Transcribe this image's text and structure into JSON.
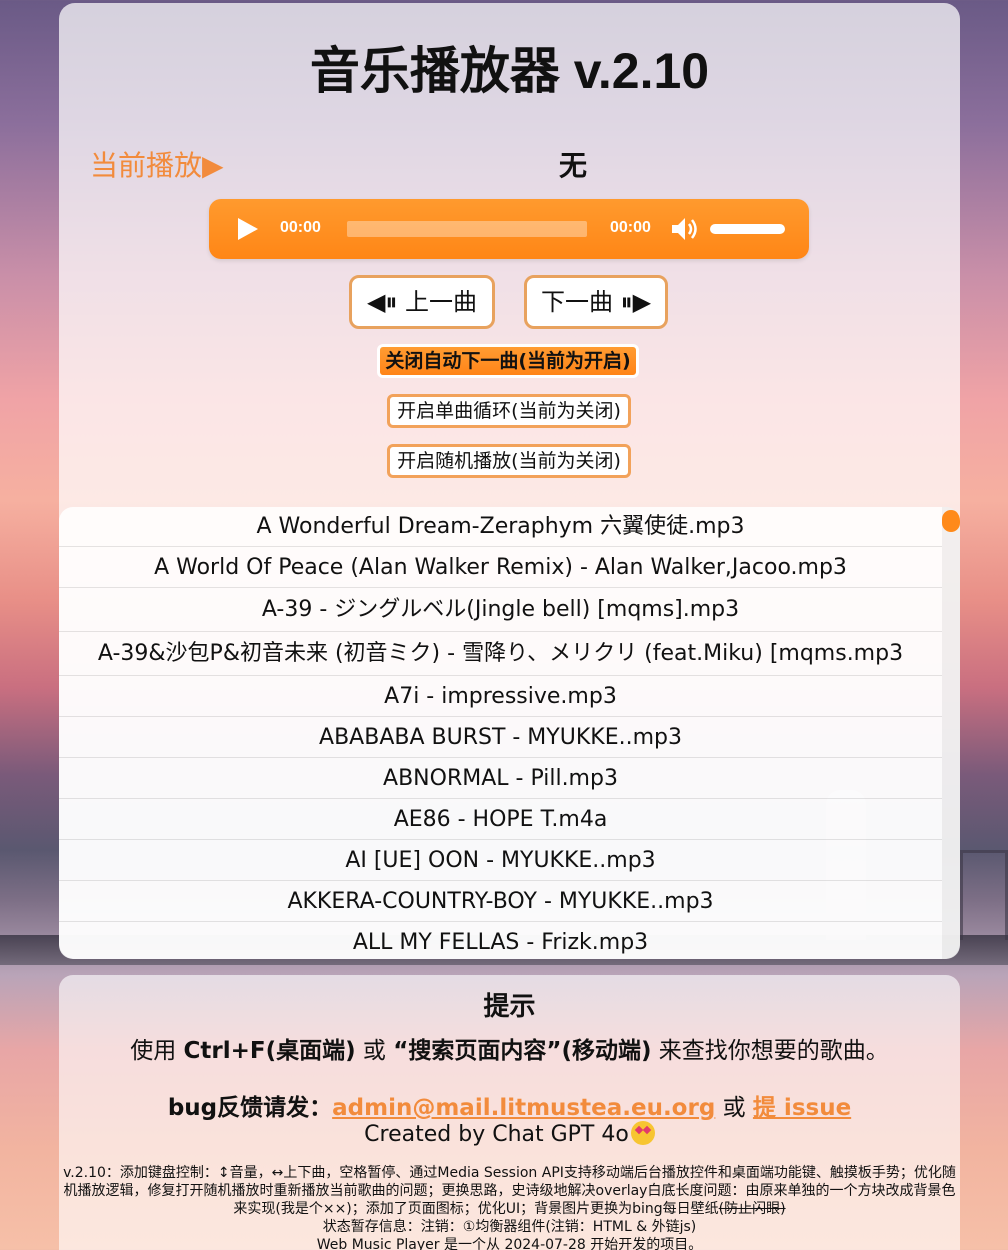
{
  "app": {
    "title": "音乐播放器 v.2.10"
  },
  "now_playing": {
    "label": "当前播放▶",
    "track": "无"
  },
  "player": {
    "current_time": "00:00",
    "duration": "00:00",
    "progress_fraction": 0,
    "volume_fraction": 1
  },
  "controls": {
    "prev_label": "◀⏸ 上一曲",
    "next_label": "下一曲 ⏸▶",
    "auto_next_label": "关闭自动下一曲(当前为开启)",
    "loop_label": "开启单曲循环(当前为关闭)",
    "shuffle_label": "开启随机播放(当前为关闭)"
  },
  "playlist": [
    "A Wonderful Dream-Zeraphym 六翼使徒.mp3",
    "A World Of Peace (Alan Walker Remix) - Alan Walker,Jacoo.mp3",
    "A-39 - ジングルベル(Jingle bell) [mqms].mp3",
    "A-39&沙包P&初音未来 (初音ミク) - 雪降り、メリクリ (feat.Miku) [mqms.mp3",
    "A7i - impressive.mp3",
    "ABABABA BURST - MYUKKE..mp3",
    "ABNORMAL - Pill.mp3",
    "AE86 - HOPE T.m4a",
    "AI [UE] OON - MYUKKE..mp3",
    "AKKERA-COUNTRY-BOY - MYUKKE..mp3",
    "ALL MY FELLAS - Frizk.mp3"
  ],
  "tips": {
    "title": "提示",
    "search_prefix": "使用 ",
    "search_key_desktop": "Ctrl+F(桌面端)",
    "search_or": " 或 ",
    "search_key_mobile": "“搜索页面内容”(移动端)",
    "search_suffix": " 来查找你想要的歌曲。",
    "bug_prefix": "bug反馈请发：",
    "bug_email": "admin@mail.litmustea.eu.org",
    "bug_or": " 或 ",
    "bug_issue": "提 issue",
    "created_by": "Created by Chat GPT 4o",
    "changelog_main": "v.2.10：添加键盘控制：↕音量，↔上下曲，空格暂停、通过Media Session API支持移动端后台播放控件和桌面端功能键、触摸板手势；优化随机播放逻辑，修复打开随机播放时重新播放当前歌曲的问题；更换思路，史诗级地解决overlay白底长度问题：由原来单独的一个方块改成背景色来实现(我是个××)；添加了页面图标；优化UI；背景图片更换为bing每日壁纸",
    "changelog_strike": "(防止闪眼)",
    "status_line": "状态暂存信息：注销：①均衡器组件(注销：HTML & 外链js)",
    "origin_line": "Web Music Player 是一个从 2024-07-28 开始开发的项目。"
  },
  "colors": {
    "accent": "#ff8a1a",
    "label_orange": "#f28b3c"
  }
}
